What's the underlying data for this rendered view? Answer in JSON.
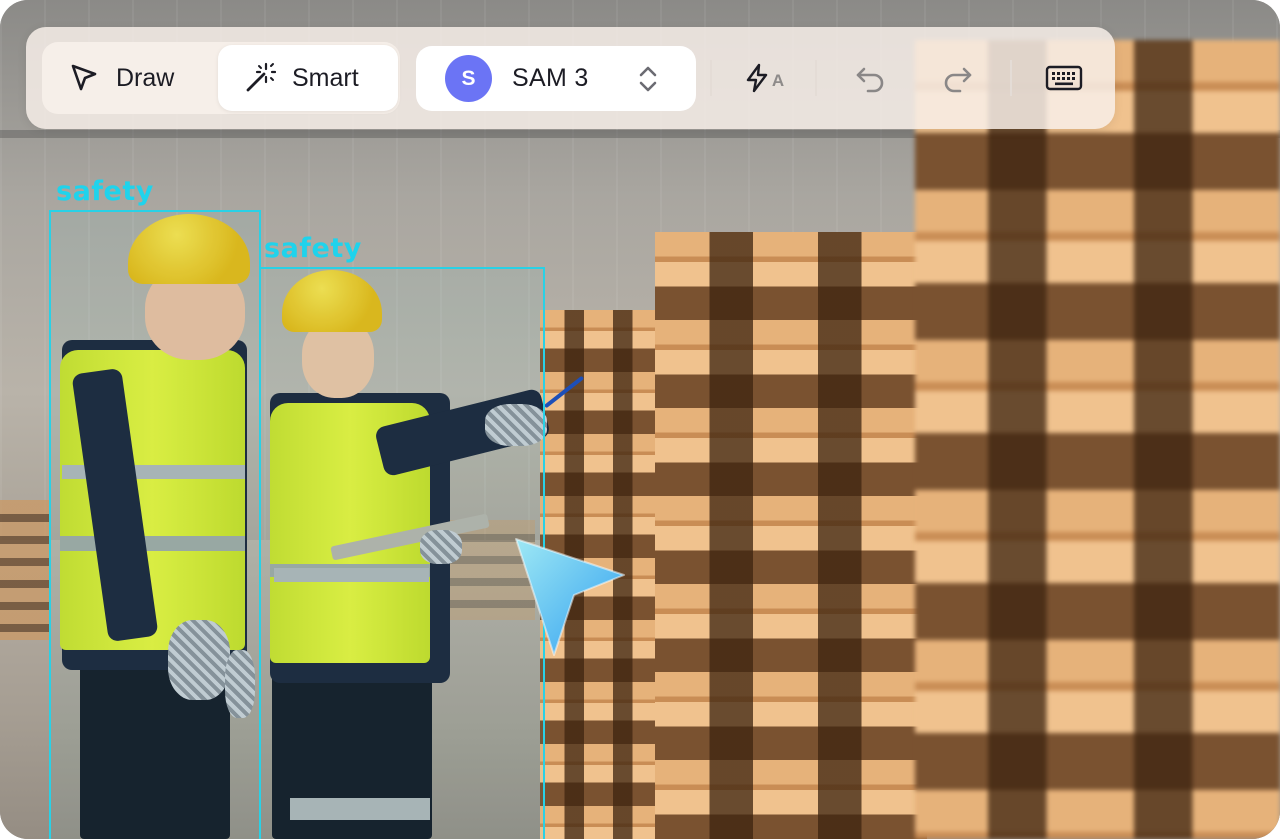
{
  "toolbar": {
    "modes": [
      {
        "label": "Draw",
        "icon": "cursor-arrow-icon",
        "selected": false
      },
      {
        "label": "Smart",
        "icon": "magic-wand-icon",
        "selected": true
      }
    ],
    "model": {
      "avatar_letter": "S",
      "name": "SAM 3",
      "avatar_color": "#6b74f5"
    },
    "auto_label_letter": "A",
    "icons": [
      "flash-auto-icon",
      "undo-icon",
      "redo-icon",
      "keyboard-icon"
    ]
  },
  "detections": [
    {
      "label": "safety"
    },
    {
      "label": "safety"
    }
  ],
  "colors": {
    "detection": "#29d1e6",
    "pointer_gradient": [
      "#8fe3f2",
      "#3aa8f0"
    ]
  }
}
